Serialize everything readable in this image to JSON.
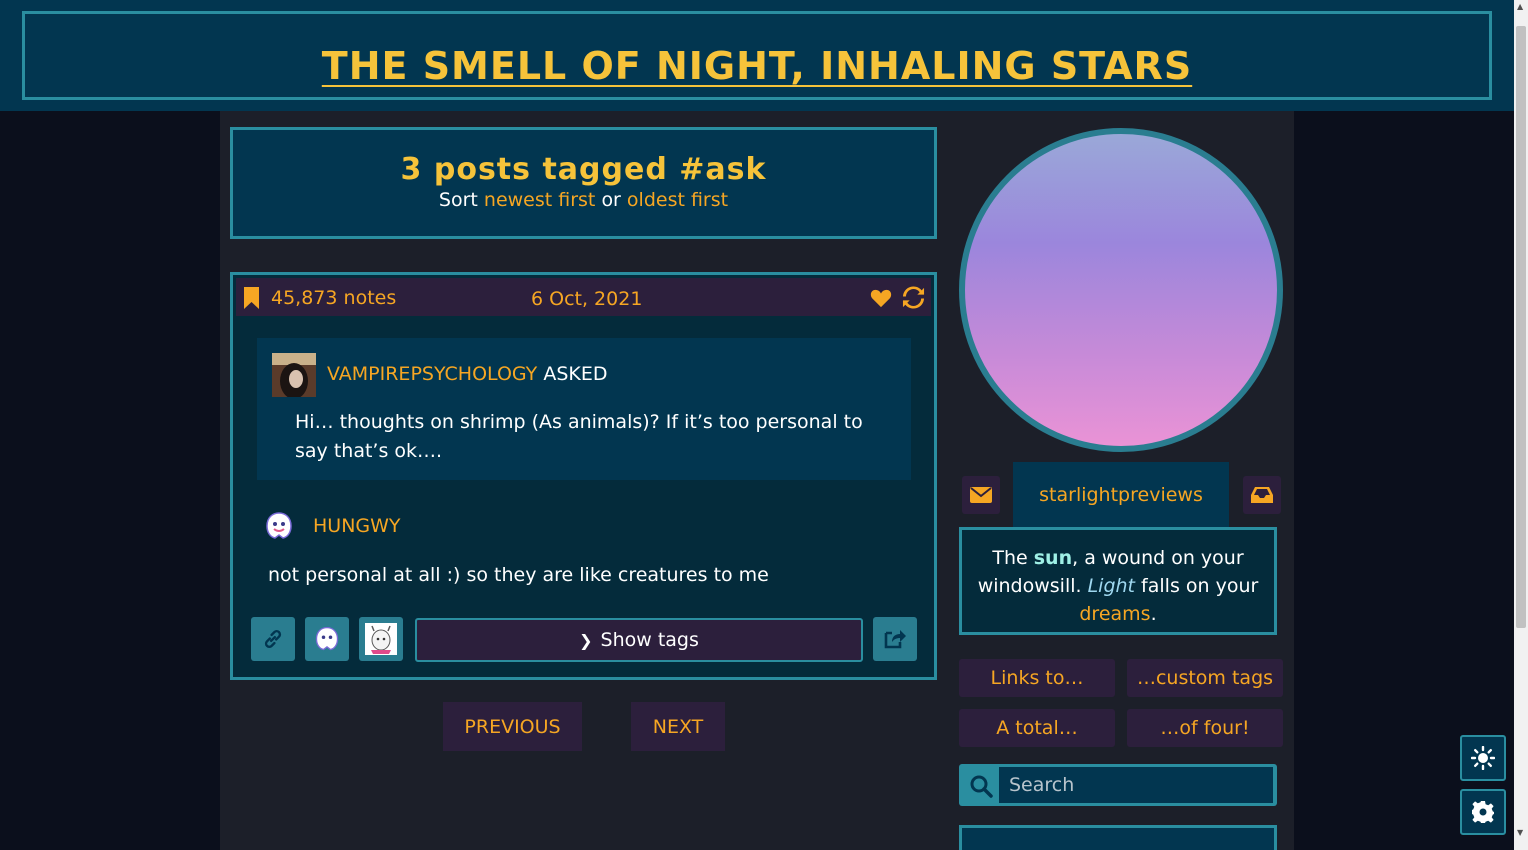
{
  "header": {
    "title": "THE SMELL OF NIGHT, INHALING STARS"
  },
  "tag_header": {
    "heading": "3 posts tagged #ask",
    "sort_prefix": "Sort",
    "sort_newest": "newest first",
    "sort_or": "or",
    "sort_oldest": "oldest first"
  },
  "post": {
    "notes": "45,873 notes",
    "date": "6 Oct, 2021",
    "ask": {
      "asker": "VAMPIREPSYCHOLOGY",
      "asked_label": "ASKED",
      "question": "Hi… thoughts on shrimp (As animals)? If it’s too personal to say that’s ok…."
    },
    "answerer": "HUNGWY",
    "answer": "not personal at all :) so they are like creatures to me",
    "show_tags": "Show tags"
  },
  "pagination": {
    "previous": "PREVIOUS",
    "next": "NEXT"
  },
  "sidebar": {
    "username": "starlightpreviews",
    "description": {
      "part1": "The ",
      "sun": "sun",
      "part2": ", a wound on your windowsill. ",
      "light": "Light",
      "part3": " falls on your ",
      "dreams": "dreams",
      "part4": "."
    },
    "links": [
      "Links to…",
      "…custom tags",
      "A total…",
      "…of four!"
    ],
    "search_placeholder": "Search"
  },
  "colors": {
    "accent": "#f6c33a",
    "link": "#f6a623",
    "border": "#2a8ea0",
    "panel": "#023650",
    "dark_panel": "#2c1f3c"
  }
}
